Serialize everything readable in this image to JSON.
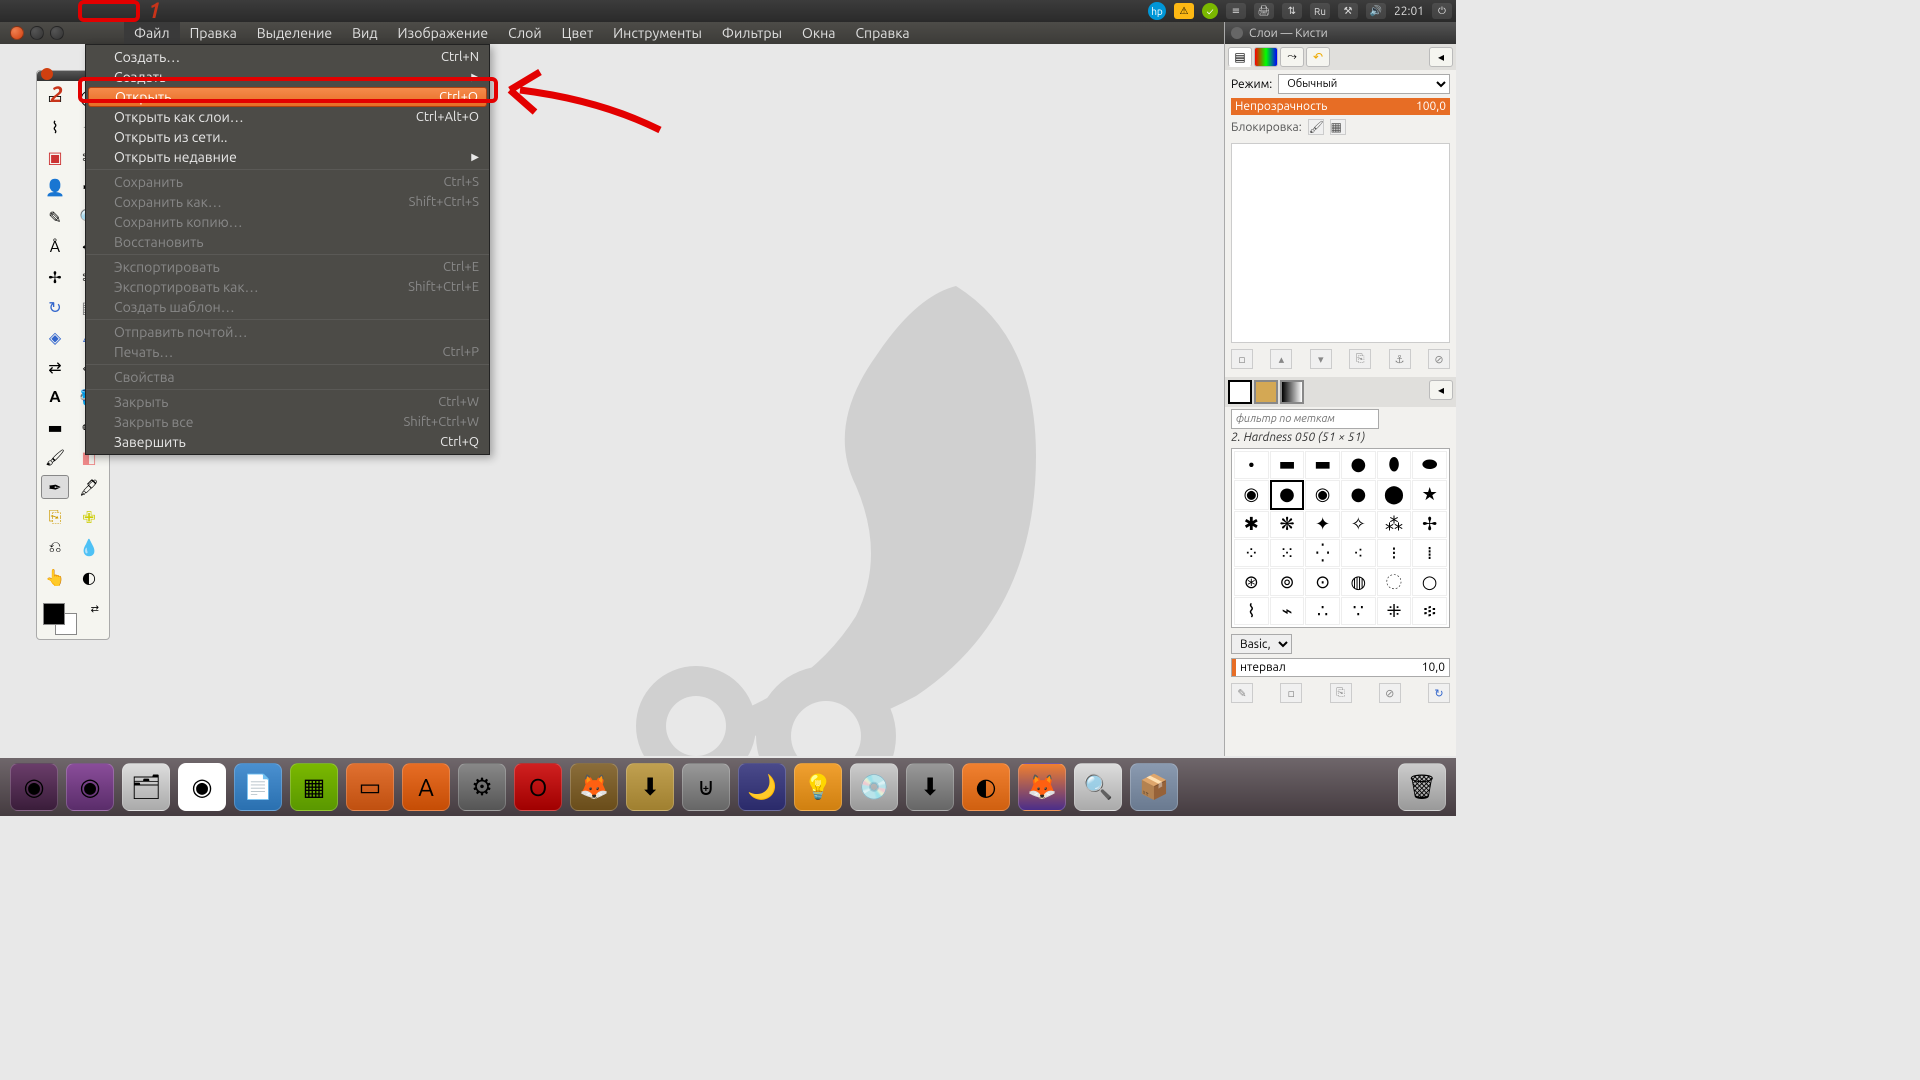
{
  "system_bar": {
    "lang": "Ru",
    "time": "22:01",
    "icons": [
      "hp",
      "warn",
      "green",
      "menu",
      "print",
      "network",
      "lang",
      "bluetooth",
      "volume"
    ]
  },
  "menu_bar": {
    "items": [
      "Файл",
      "Правка",
      "Выделение",
      "Вид",
      "Изображение",
      "Слой",
      "Цвет",
      "Инструменты",
      "Фильтры",
      "Окна",
      "Справка"
    ],
    "open_index": 0
  },
  "dropdown": {
    "groups": [
      [
        {
          "label": "Создать…",
          "shortcut": "Ctrl+N",
          "disabled": false
        },
        {
          "label": "Создать",
          "submenu": true,
          "disabled": false
        },
        {
          "label": "Открыть…",
          "shortcut": "Ctrl+O",
          "hover": true,
          "disabled": false
        },
        {
          "label": "Открыть как слои…",
          "shortcut": "Ctrl+Alt+O",
          "disabled": false
        },
        {
          "label": "Открыть из сети..",
          "disabled": false
        },
        {
          "label": "Открыть недавние",
          "submenu": true,
          "disabled": false
        }
      ],
      [
        {
          "label": "Сохранить",
          "shortcut": "Ctrl+S",
          "disabled": true
        },
        {
          "label": "Сохранить как…",
          "shortcut": "Shift+Ctrl+S",
          "disabled": true
        },
        {
          "label": "Сохранить копию…",
          "disabled": true
        },
        {
          "label": "Восстановить",
          "disabled": true
        }
      ],
      [
        {
          "label": "Экспортировать",
          "shortcut": "Ctrl+E",
          "disabled": true
        },
        {
          "label": "Экспортировать как…",
          "shortcut": "Shift+Ctrl+E",
          "disabled": true
        },
        {
          "label": "Создать шаблон…",
          "disabled": true
        }
      ],
      [
        {
          "label": "Отправить почтой…",
          "disabled": true
        },
        {
          "label": "Печать…",
          "shortcut": "Ctrl+P",
          "disabled": true
        }
      ],
      [
        {
          "label": "Свойства",
          "disabled": true
        }
      ],
      [
        {
          "label": "Закрыть",
          "shortcut": "Ctrl+W",
          "disabled": true
        },
        {
          "label": "Закрыть все",
          "shortcut": "Shift+Ctrl+W",
          "disabled": true
        },
        {
          "label": "Завершить",
          "shortcut": "Ctrl+Q",
          "disabled": false
        }
      ]
    ]
  },
  "right_dock": {
    "title": "Слои — Кисти",
    "mode_label": "Режим:",
    "mode_value": "Обычный",
    "opacity_label": "Непрозрачность",
    "opacity_value": "100,0",
    "lock_label": "Блокировка:",
    "brush_filter_placeholder": "фильтр по меткам",
    "brush_name": "2. Hardness 050 (51 × 51)",
    "brush_preset": "Basic,",
    "interval_label": "нтервал",
    "interval_value": "10,0"
  },
  "annotations": {
    "number_1": "1",
    "number_2": "2"
  }
}
